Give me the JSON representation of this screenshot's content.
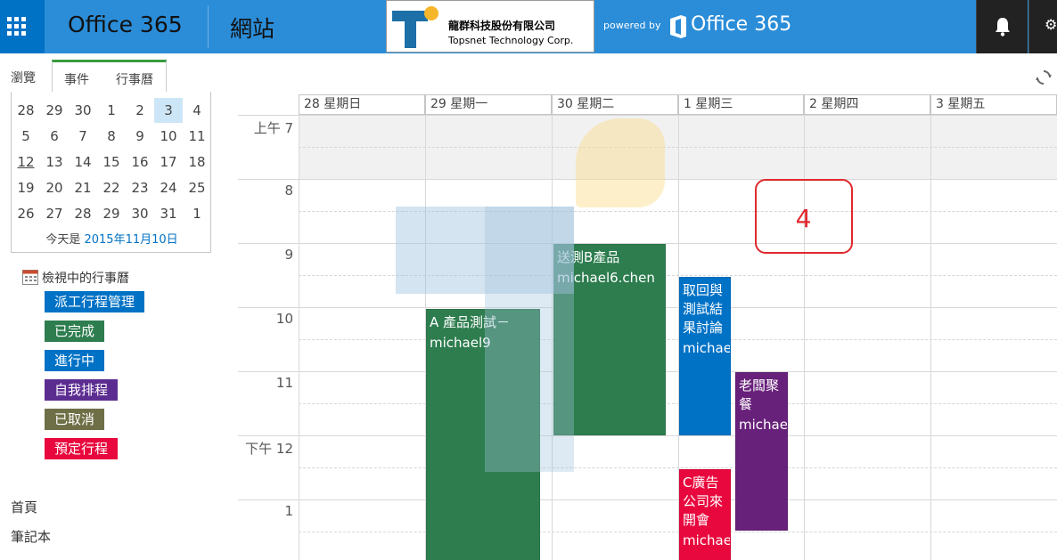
{
  "suite": {
    "brand": "Office 365",
    "site_title": "網站",
    "logo_cn": "龍群科技股份有限公司",
    "logo_en": "Topsnet Technology Corp.",
    "powered_by": "powered by",
    "powered_brand": "Office 365"
  },
  "ribbon": {
    "browse": "瀏覽",
    "events": "事件",
    "calendar": "行事曆"
  },
  "datepicker": {
    "weeks": [
      [
        "28",
        "29",
        "30",
        "1",
        "2",
        "3",
        "4"
      ],
      [
        "5",
        "6",
        "7",
        "8",
        "9",
        "10",
        "11"
      ],
      [
        "12",
        "13",
        "14",
        "15",
        "16",
        "17",
        "18"
      ],
      [
        "19",
        "20",
        "21",
        "22",
        "23",
        "24",
        "25"
      ],
      [
        "26",
        "27",
        "28",
        "29",
        "30",
        "31",
        "1"
      ]
    ],
    "selected": "3",
    "today_prefix": "今天是",
    "today_link": "2015年11月10日"
  },
  "calendars": {
    "header": "檢視中的行事曆",
    "items": [
      {
        "label": "派工行程管理",
        "color": "#0072c6"
      },
      {
        "label": "已完成",
        "color": "#2e7d4f"
      },
      {
        "label": "進行中",
        "color": "#0072c6"
      },
      {
        "label": "自我排程",
        "color": "#5c2d91"
      },
      {
        "label": "已取消",
        "color": "#6f6f47"
      },
      {
        "label": "預定行程",
        "color": "#e8083e"
      }
    ]
  },
  "nav": {
    "home": "首頁",
    "notebook": "筆記本"
  },
  "week": {
    "days": [
      "28 星期日",
      "29 星期一",
      "30 星期二",
      "1 星期三",
      "2 星期四",
      "3 星期五"
    ],
    "hours": [
      "上午 7",
      "8",
      "9",
      "10",
      "11",
      "下午 12",
      "1"
    ]
  },
  "events": [
    {
      "title": "A 產品測試－",
      "owner": "michael9",
      "color": "#2e7d4f"
    },
    {
      "title": "送測B產品",
      "owner": "michael6.chen",
      "color": "#2e7d4f"
    },
    {
      "title": "取回與測試結果討論",
      "owner": "michae",
      "color": "#0072c6"
    },
    {
      "title": "老闆聚餐",
      "owner": "michae",
      "color": "#68217a"
    },
    {
      "title": "C廣告公司來開會",
      "owner": "michae",
      "color": "#e8083e"
    }
  ],
  "annotation": "4"
}
